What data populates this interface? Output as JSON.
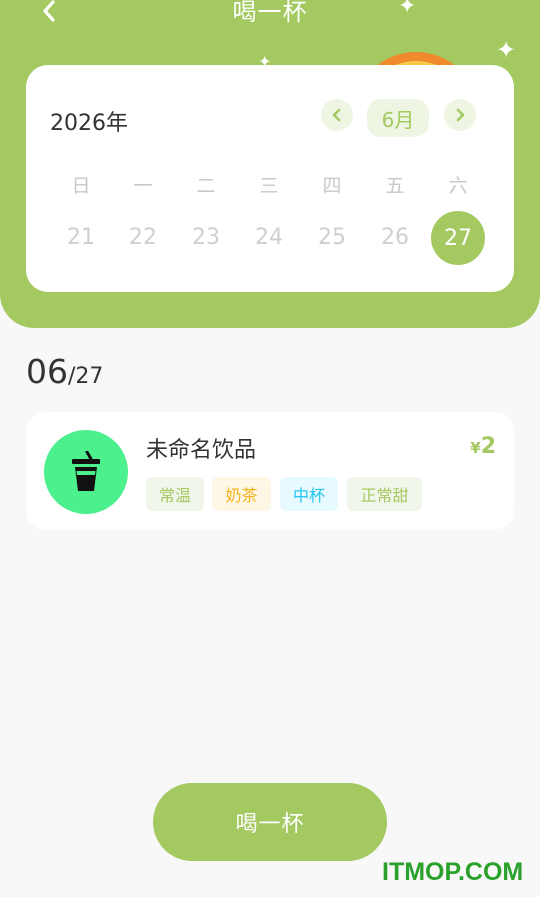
{
  "nav": {
    "title": "喝一杯"
  },
  "calendar": {
    "year": "2026年",
    "month": "6月",
    "weekdays": [
      "日",
      "一",
      "二",
      "三",
      "四",
      "五",
      "六"
    ],
    "days": [
      "21",
      "22",
      "23",
      "24",
      "25",
      "26",
      "27"
    ],
    "selected_day": "27"
  },
  "day_heading": {
    "month": "06",
    "day": "/27"
  },
  "record": {
    "name": "未命名饮品",
    "currency": "¥",
    "price": "2",
    "tags": [
      "常温",
      "奶茶",
      "中杯",
      "正常甜"
    ]
  },
  "actions": {
    "drink_label": "喝一杯"
  },
  "watermark": "ITMOP.COM",
  "colors": {
    "accent": "#a3c960",
    "avatar": "#4cf08c",
    "tag_temp_bg": "#f1f6ea",
    "tag_temp_fg": "#a3c960",
    "tag_type_bg": "#fff7e6",
    "tag_type_fg": "#f5b01a",
    "tag_size_bg": "#e6faff",
    "tag_size_fg": "#23c6f0",
    "tag_sweet_bg": "#f1f6ea",
    "tag_sweet_fg": "#a3c960"
  }
}
